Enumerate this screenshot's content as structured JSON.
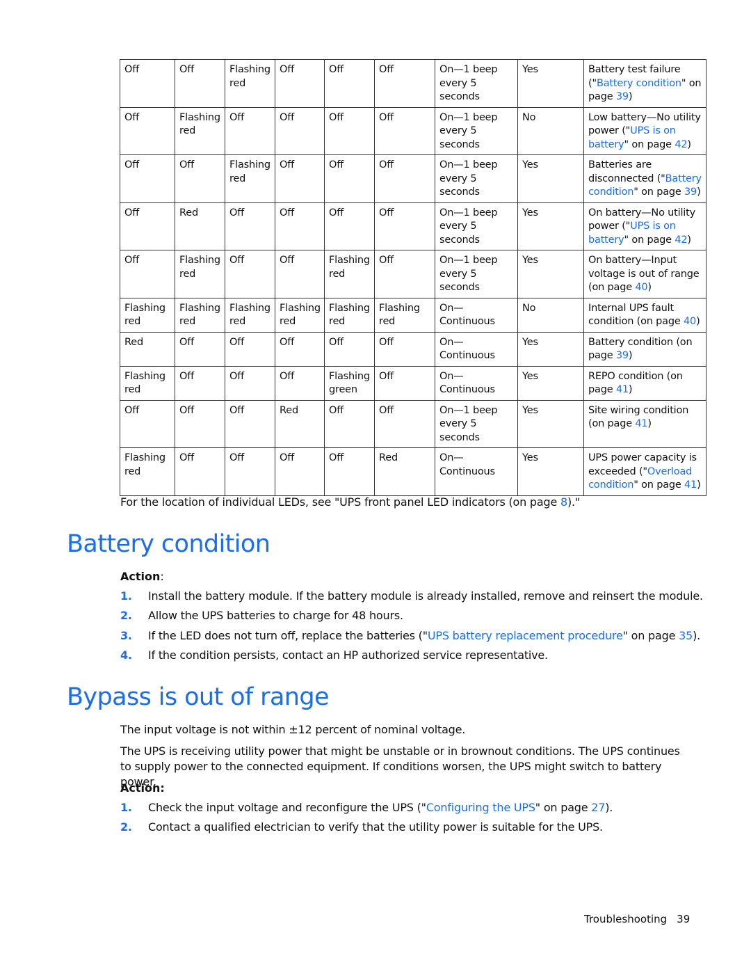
{
  "table": {
    "rows": [
      {
        "leds": [
          "Off",
          "Off",
          "Flashing red",
          "Off",
          "Off",
          "Off"
        ],
        "alarm": "On—1 beep every 5 seconds",
        "alarm_silenced": "Yes",
        "condition": [
          {
            "t": "Battery test failure ("
          },
          {
            "t": "\"",
            "l": false
          },
          {
            "t": "Battery condition",
            "l": true
          },
          {
            "t": "\" on page "
          },
          {
            "t": "39",
            "l": true
          },
          {
            "t": ")"
          }
        ]
      },
      {
        "leds": [
          "Off",
          "Flashing red",
          "Off",
          "Off",
          "Off",
          "Off"
        ],
        "alarm": "On—1 beep every 5 seconds",
        "alarm_silenced": "No",
        "condition": [
          {
            "t": "Low battery—No utility power (\""
          },
          {
            "t": "UPS is on battery",
            "l": true
          },
          {
            "t": "\" on page "
          },
          {
            "t": "42",
            "l": true
          },
          {
            "t": ")"
          }
        ]
      },
      {
        "leds": [
          "Off",
          "Off",
          "Flashing red",
          "Off",
          "Off",
          "Off"
        ],
        "alarm": "On—1 beep every 5 seconds",
        "alarm_silenced": "Yes",
        "condition": [
          {
            "t": "Batteries are disconnected (\""
          },
          {
            "t": "Battery condition",
            "l": true
          },
          {
            "t": "\" on page "
          },
          {
            "t": "39",
            "l": true
          },
          {
            "t": ")"
          }
        ]
      },
      {
        "leds": [
          "Off",
          "Red",
          "Off",
          "Off",
          "Off",
          "Off"
        ],
        "alarm": "On—1 beep every 5 seconds",
        "alarm_silenced": "Yes",
        "condition": [
          {
            "t": "On battery—No utility power (\""
          },
          {
            "t": "UPS is on battery",
            "l": true
          },
          {
            "t": "\" on page "
          },
          {
            "t": "42",
            "l": true
          },
          {
            "t": ")"
          }
        ]
      },
      {
        "leds": [
          "Off",
          "Flashing red",
          "Off",
          "Off",
          "Flashing red",
          "Off"
        ],
        "alarm": "On—1 beep every 5 seconds",
        "alarm_silenced": "Yes",
        "condition": [
          {
            "t": "On battery—Input voltage is out of range (on page "
          },
          {
            "t": "40",
            "l": true
          },
          {
            "t": ")"
          }
        ]
      },
      {
        "leds": [
          "Flashing red",
          "Flashing red",
          "Flashing red",
          "Flashing red",
          "Flashing red",
          "Flashing red"
        ],
        "alarm": "On—Continuous",
        "alarm_silenced": "No",
        "condition": [
          {
            "t": "Internal UPS fault condition (on page "
          },
          {
            "t": "40",
            "l": true
          },
          {
            "t": ")"
          }
        ]
      },
      {
        "leds": [
          "Red",
          "Off",
          "Off",
          "Off",
          "Off",
          "Off"
        ],
        "alarm": "On—Continuous",
        "alarm_silenced": "Yes",
        "condition": [
          {
            "t": "Battery condition (on page "
          },
          {
            "t": "39",
            "l": true
          },
          {
            "t": ")"
          }
        ]
      },
      {
        "leds": [
          "Flashing red",
          "Off",
          "Off",
          "Off",
          "Flashing green",
          "Off"
        ],
        "alarm": "On—Continuous",
        "alarm_silenced": "Yes",
        "condition": [
          {
            "t": "REPO condition (on page "
          },
          {
            "t": "41",
            "l": true
          },
          {
            "t": ")"
          }
        ]
      },
      {
        "leds": [
          "Off",
          "Off",
          "Off",
          "Red",
          "Off",
          "Off"
        ],
        "alarm": "On—1 beep every 5 seconds",
        "alarm_silenced": "Yes",
        "condition": [
          {
            "t": "Site wiring condition (on page "
          },
          {
            "t": "41",
            "l": true
          },
          {
            "t": ")"
          }
        ]
      },
      {
        "leds": [
          "Flashing red",
          "Off",
          "Off",
          "Off",
          "Off",
          "Red"
        ],
        "alarm": "On—Continuous",
        "alarm_silenced": "Yes",
        "condition": [
          {
            "t": "UPS power capacity is exceeded (\""
          },
          {
            "t": "Overload condition",
            "l": true
          },
          {
            "t": "\" on page "
          },
          {
            "t": "41",
            "l": true
          },
          {
            "t": ")"
          }
        ]
      }
    ]
  },
  "note": {
    "before": "For the location of individual LEDs, see \"UPS front panel LED indicators (on page ",
    "page": "8",
    "after": ").\""
  },
  "battery_condition": {
    "title": "Battery condition",
    "action_label": "Action",
    "action_colon": ":",
    "steps": [
      {
        "num": "1.",
        "parts": [
          {
            "t": "Install the battery module. If the battery module is already installed, remove and reinsert the module."
          }
        ]
      },
      {
        "num": "2.",
        "parts": [
          {
            "t": "Allow the UPS batteries to charge for 48 hours."
          }
        ]
      },
      {
        "num": "3.",
        "parts": [
          {
            "t": "If the LED does not turn off, replace the batteries (\""
          },
          {
            "t": "UPS battery replacement procedure",
            "l": true
          },
          {
            "t": "\" on page "
          },
          {
            "t": "35",
            "l": true
          },
          {
            "t": ")."
          }
        ]
      },
      {
        "num": "4.",
        "parts": [
          {
            "t": "If the condition persists, contact an HP authorized service representative."
          }
        ]
      }
    ]
  },
  "bypass": {
    "title": "Bypass is out of range",
    "para1": "The input voltage is not within ±12 percent of nominal voltage.",
    "para2": "The UPS is receiving utility power that might be unstable or in brownout conditions. The UPS continues to supply power to the connected equipment. If conditions worsen, the UPS might switch to battery power.",
    "action_label": "Action:",
    "steps": [
      {
        "num": "1.",
        "parts": [
          {
            "t": "Check the input voltage and reconfigure the UPS (\""
          },
          {
            "t": "Configuring the UPS",
            "l": true
          },
          {
            "t": "\" on page "
          },
          {
            "t": "27",
            "l": true
          },
          {
            "t": ")."
          }
        ]
      },
      {
        "num": "2.",
        "parts": [
          {
            "t": "Contact a qualified electrician to verify that the utility power is suitable for the UPS."
          }
        ]
      }
    ]
  },
  "footer": {
    "section": "Troubleshooting",
    "page": "39"
  },
  "colors": {
    "link": "#1a6ee8",
    "heading": "#1a6ee8",
    "text": "#111111",
    "border": "#333333"
  }
}
